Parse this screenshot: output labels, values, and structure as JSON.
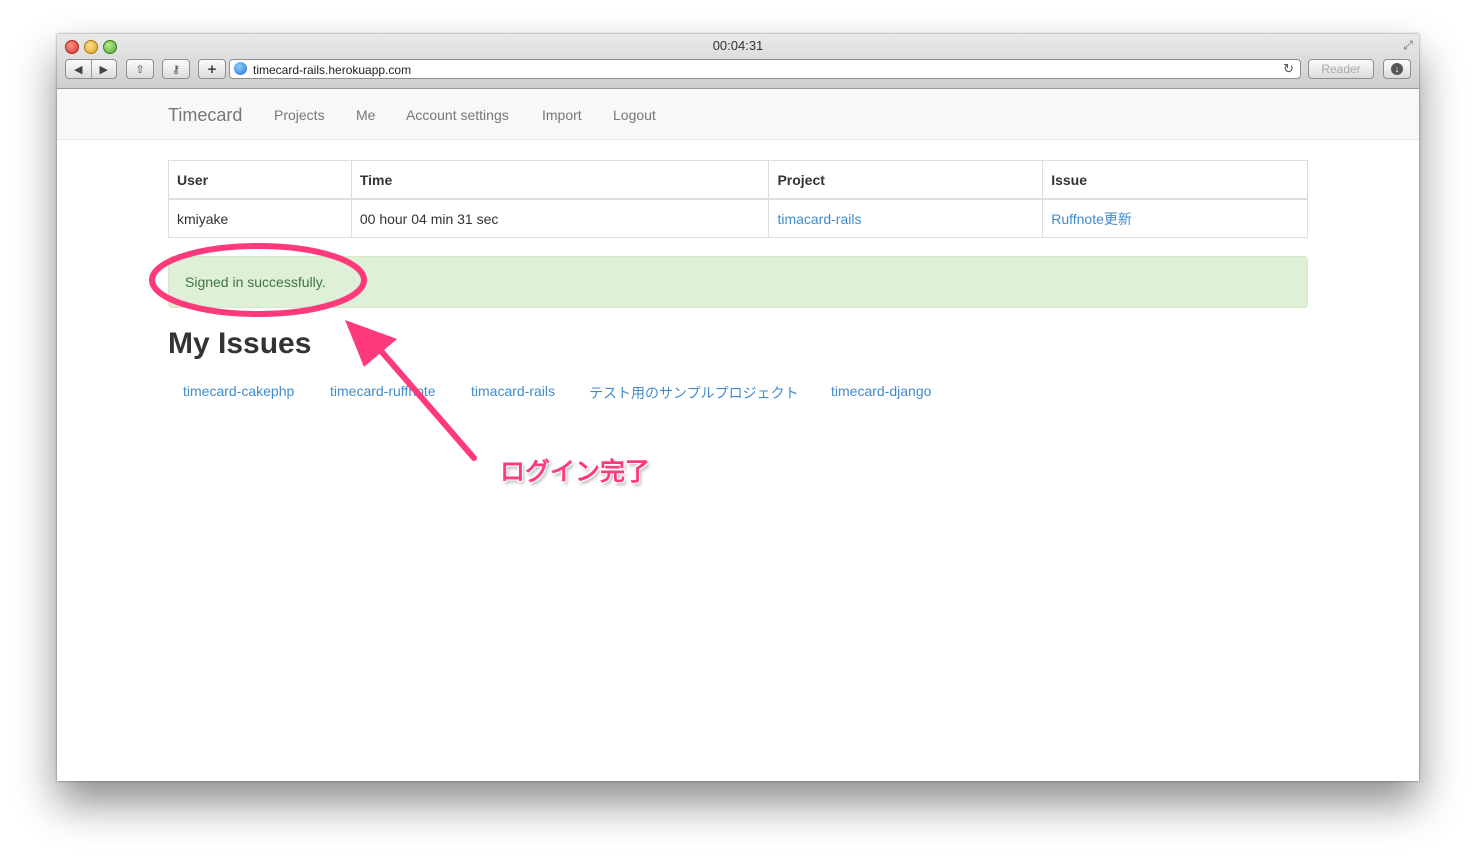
{
  "window": {
    "title": "00:04:31",
    "url": "timecard-rails.herokuapp.com",
    "reader_label": "Reader"
  },
  "icons": {
    "back": "◀",
    "forward": "▶",
    "share": "⇧",
    "key": "⚷",
    "plus": "+",
    "reload": "↻",
    "download": "↓",
    "fullscreen": "⤢"
  },
  "navbar": {
    "brand": "Timecard",
    "links": [
      "Projects",
      "Me",
      "Account settings",
      "Import",
      "Logout"
    ]
  },
  "current_work": {
    "headers": [
      "User",
      "Time",
      "Project",
      "Issue"
    ],
    "row": {
      "user": "kmiyake",
      "time": "00 hour 04 min 31 sec",
      "project": "timacard-rails",
      "issue": "Ruffnote更新"
    }
  },
  "alert": {
    "message": "Signed in successfully."
  },
  "my_issues": {
    "title": "My Issues",
    "items": [
      "timecard-cakephp",
      "timecard-ruffnote",
      "timacard-rails",
      "テスト用のサンプルプロジェクト",
      "timecard-django"
    ]
  },
  "annotation": {
    "label": "ログイン完了",
    "color": "#ff3a7a"
  }
}
